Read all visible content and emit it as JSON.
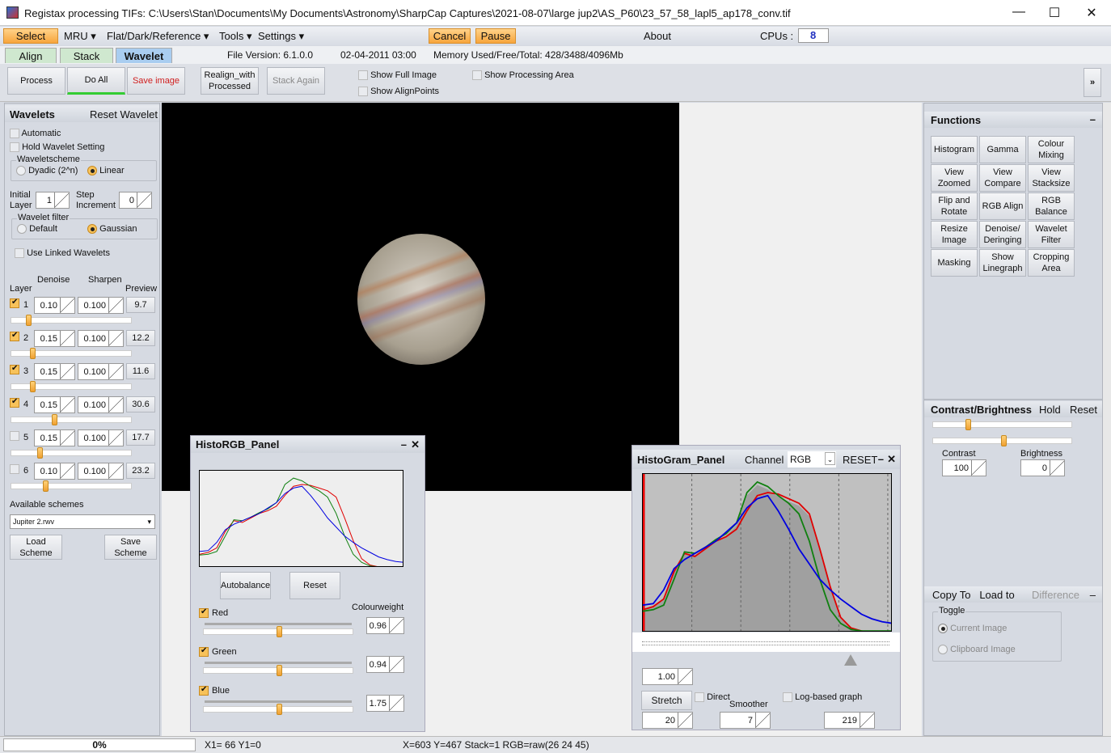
{
  "window": {
    "title": "Registax processing TIFs: C:\\Users\\Stan\\Documents\\My Documents\\Astronomy\\SharpCap Captures\\2021-08-07\\large jup2\\AS_P60\\23_57_58_lapl5_ap178_conv.tif",
    "minimize": "—",
    "maximize": "☐",
    "close": "✕"
  },
  "menu": {
    "select": "Select",
    "mru": "MRU ▾",
    "flat": "Flat/Dark/Reference ▾",
    "tools": "Tools ▾",
    "settings": "Settings ▾",
    "cancel": "Cancel",
    "pause": "Pause",
    "about": "About",
    "cpus_label": "CPUs :",
    "cpus_value": "8"
  },
  "tabs": {
    "align": "Align",
    "stack": "Stack",
    "wavelet": "Wavelet",
    "file_version": "File Version: 6.1.0.0",
    "date": "02-04-2011 03:00",
    "memory": "Memory Used/Free/Total: 428/3488/4096Mb"
  },
  "toolbar": {
    "process": "Process",
    "do_all": "Do All",
    "save_image": "Save image",
    "realign": "Realign_with Processed",
    "stack_again": "Stack Again",
    "show_full": "Show Full Image",
    "show_alignpoints": "Show AlignPoints",
    "show_processing": "Show Processing Area",
    "expand": "»"
  },
  "wavelets": {
    "title": "Wavelets",
    "reset": "Reset Wavelet",
    "automatic": "Automatic",
    "hold": "Hold Wavelet Setting",
    "scheme_label": "Waveletscheme",
    "dyadic": "Dyadic (2^n)",
    "linear": "Linear",
    "initial_layer": "Initial Layer",
    "initial_value": "1",
    "step_inc": "Step Increment",
    "step_value": "0",
    "filter_label": "Wavelet filter",
    "default": "Default",
    "gaussian": "Gaussian",
    "linked": "Use Linked Wavelets",
    "col_denoise": "Denoise",
    "col_sharpen": "Sharpen",
    "col_layer": "Layer",
    "col_preview": "Preview",
    "layers": [
      {
        "n": "1",
        "checked": true,
        "denoise": "0.10",
        "sharpen": "0.100",
        "preview": "9.7",
        "slider": 0.14
      },
      {
        "n": "2",
        "checked": true,
        "denoise": "0.15",
        "sharpen": "0.100",
        "preview": "12.2",
        "slider": 0.17
      },
      {
        "n": "3",
        "checked": true,
        "denoise": "0.15",
        "sharpen": "0.100",
        "preview": "11.6",
        "slider": 0.17
      },
      {
        "n": "4",
        "checked": true,
        "denoise": "0.15",
        "sharpen": "0.100",
        "preview": "30.6",
        "slider": 0.35
      },
      {
        "n": "5",
        "checked": false,
        "denoise": "0.15",
        "sharpen": "0.100",
        "preview": "17.7",
        "slider": 0.23
      },
      {
        "n": "6",
        "checked": false,
        "denoise": "0.10",
        "sharpen": "0.100",
        "preview": "23.2",
        "slider": 0.28
      }
    ],
    "schemes_label": "Available schemes",
    "scheme_value": "Jupiter 2.rwv",
    "load": "Load Scheme",
    "save": "Save Scheme"
  },
  "functions": {
    "title": "Functions",
    "collapse": "–",
    "buttons": [
      {
        "label": "Histogram",
        "active": true
      },
      {
        "label": "Gamma"
      },
      {
        "label": "Colour Mixing"
      },
      {
        "label": "View Zoomed"
      },
      {
        "label": "View Compare"
      },
      {
        "label": "View Stacksize"
      },
      {
        "label": "Flip and Rotate"
      },
      {
        "label": "RGB Align"
      },
      {
        "label": "RGB Balance",
        "active": true
      },
      {
        "label": "Resize Image"
      },
      {
        "label": "Denoise/ Deringing"
      },
      {
        "label": "Wavelet Filter"
      },
      {
        "label": "Masking"
      },
      {
        "label": "Show Linegraph"
      },
      {
        "label": "Cropping Area"
      }
    ]
  },
  "contrast": {
    "title": "Contrast/Brightness",
    "hold": "Hold",
    "reset": "Reset",
    "contrast_label": "Contrast",
    "contrast_value": "100",
    "brightness_label": "Brightness",
    "brightness_value": "0",
    "contrast_slider": 0.25,
    "brightness_slider": 0.5
  },
  "copy": {
    "copy_to": "Copy To",
    "load_to": "Load to",
    "difference": "Difference",
    "collapse": "–",
    "toggle": "Toggle",
    "current": "Current Image",
    "clipboard": "Clipboard Image"
  },
  "histo_rgb": {
    "title": "HistoRGB_Panel",
    "min": "–",
    "close": "✕",
    "autobalance": "Autobalance",
    "reset": "Reset",
    "colourweight": "Colourweight",
    "red": "Red",
    "red_value": "0.96",
    "green": "Green",
    "green_value": "0.94",
    "blue": "Blue",
    "blue_value": "1.75",
    "slider": 0.5
  },
  "histogram": {
    "title": "HistoGram_Panel",
    "channel_label": "Channel",
    "channel_value": "RGB",
    "reset": "RESET",
    "min": "–",
    "close": "✕",
    "gamma": "1.00",
    "stretch": "Stretch",
    "direct": "Direct",
    "smoother": "Smoother",
    "log_graph": "Log-based graph",
    "stretch_value": "20",
    "smoother_value": "7",
    "right_value": "219",
    "colors": {
      "red": "#e00000",
      "green": "#108010",
      "blue": "#0000e0"
    },
    "red": [
      0.15,
      0.17,
      0.22,
      0.4,
      0.52,
      0.5,
      0.55,
      0.6,
      0.63,
      0.68,
      0.8,
      0.9,
      0.92,
      0.91,
      0.88,
      0.85,
      0.78,
      0.55,
      0.3,
      0.1,
      0.03,
      0.01,
      0,
      0,
      0
    ],
    "green": [
      0.14,
      0.15,
      0.18,
      0.35,
      0.53,
      0.52,
      0.56,
      0.61,
      0.65,
      0.72,
      0.92,
      0.99,
      0.96,
      0.9,
      0.85,
      0.78,
      0.6,
      0.35,
      0.15,
      0.06,
      0.02,
      0.01,
      0.01,
      0.01,
      0.01
    ],
    "blue": [
      0.18,
      0.19,
      0.28,
      0.42,
      0.48,
      0.52,
      0.56,
      0.6,
      0.66,
      0.72,
      0.82,
      0.88,
      0.9,
      0.8,
      0.68,
      0.55,
      0.45,
      0.35,
      0.28,
      0.22,
      0.17,
      0.12,
      0.09,
      0.07,
      0.06
    ]
  },
  "status": {
    "progress": "0%",
    "xy1": "X1= 66 Y1=0",
    "pixel": "X=603 Y=467 Stack=1 RGB=raw(26 24 45)"
  }
}
